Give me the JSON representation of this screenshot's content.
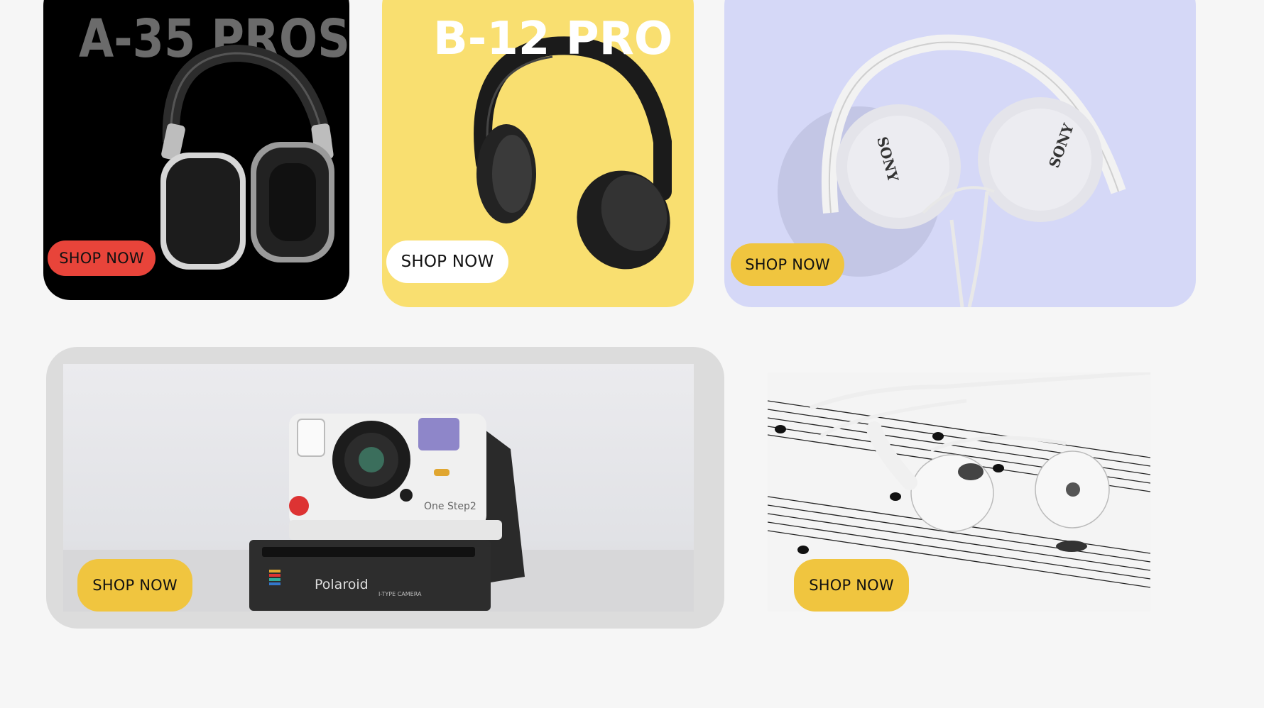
{
  "colors": {
    "page_bg": "#f6f6f6",
    "card1_bg": "#000000",
    "card2_bg": "#f9df70",
    "card3_bg": "#d5d8f7",
    "card4_bg": "#dcdcdc",
    "btn_red": "#e8443a",
    "btn_white": "#ffffff",
    "btn_yellow": "#f0c53f",
    "title1": "#6b6b6b",
    "title2": "#ffffff"
  },
  "cards": [
    {
      "title": "A-35 PROS",
      "button": "SHOP NOW",
      "image": "black-over-ear-headphones-photo"
    },
    {
      "title": "B-12 PRO",
      "button": "SHOP NOW",
      "image": "black-headphones-on-yellow-photo"
    },
    {
      "button": "SHOP NOW",
      "image": "white-sony-headphones-photo",
      "brand_left": "SONY",
      "brand_right": "SONY"
    },
    {
      "button": "SHOP NOW",
      "image": "polaroid-instant-camera-photo",
      "camera_brand": "Polaroid",
      "camera_model": "One Step2",
      "camera_type": "I-TYPE CAMERA"
    },
    {
      "button": "SHOP NOW",
      "image": "white-earbuds-on-sheet-music-photo"
    }
  ]
}
